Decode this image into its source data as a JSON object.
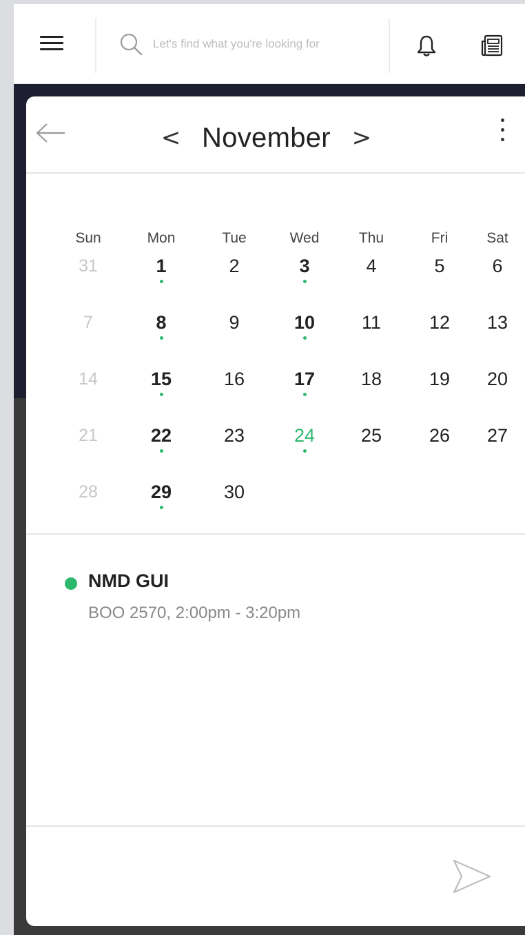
{
  "header": {
    "search_placeholder": "Let's find what you're looking for"
  },
  "calendar": {
    "month": "November",
    "weekdays": [
      "Sun",
      "Mon",
      "Tue",
      "Wed",
      "Thu",
      "Fri",
      "Sat"
    ],
    "weeks": [
      [
        {
          "d": "31",
          "muted": true
        },
        {
          "d": "1",
          "bold": true,
          "dot": true
        },
        {
          "d": "2"
        },
        {
          "d": "3",
          "bold": true,
          "dot": true
        },
        {
          "d": "4"
        },
        {
          "d": "5"
        },
        {
          "d": "6"
        }
      ],
      [
        {
          "d": "7",
          "muted": true
        },
        {
          "d": "8",
          "bold": true,
          "dot": true
        },
        {
          "d": "9"
        },
        {
          "d": "10",
          "bold": true,
          "dot": true
        },
        {
          "d": "11"
        },
        {
          "d": "12"
        },
        {
          "d": "13"
        }
      ],
      [
        {
          "d": "14",
          "muted": true
        },
        {
          "d": "15",
          "bold": true,
          "dot": true
        },
        {
          "d": "16"
        },
        {
          "d": "17",
          "bold": true,
          "dot": true
        },
        {
          "d": "18"
        },
        {
          "d": "19"
        },
        {
          "d": "20"
        }
      ],
      [
        {
          "d": "21",
          "muted": true
        },
        {
          "d": "22",
          "bold": true,
          "dot": true
        },
        {
          "d": "23"
        },
        {
          "d": "24",
          "today": true,
          "dot": true
        },
        {
          "d": "25"
        },
        {
          "d": "26"
        },
        {
          "d": "27"
        }
      ],
      [
        {
          "d": "28",
          "muted": true
        },
        {
          "d": "29",
          "bold": true,
          "dot": true
        },
        {
          "d": "30"
        },
        {
          "d": ""
        },
        {
          "d": ""
        },
        {
          "d": ""
        },
        {
          "d": ""
        }
      ]
    ]
  },
  "event": {
    "title": "NMD GUI",
    "details": "BOO 2570, 2:00pm - 3:20pm"
  },
  "colors": {
    "accent": "#2db96d",
    "header_dark": "#1d1e30"
  },
  "icons": [
    "hamburger-menu-icon",
    "search-icon",
    "bell-icon",
    "newspaper-icon",
    "back-arrow-icon",
    "chevron-left-icon",
    "chevron-right-icon",
    "more-vertical-icon",
    "send-icon"
  ]
}
